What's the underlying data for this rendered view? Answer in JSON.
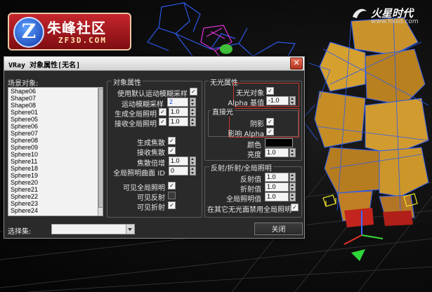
{
  "logos": {
    "left": {
      "badge": "Z",
      "title": "朱峰社区",
      "subtitle": "ZF3D.COM"
    },
    "right": {
      "title": "火星时代",
      "subtitle": "www.hxsd.com"
    }
  },
  "dialog": {
    "title": "VRay 对象属性[无名]",
    "close_glyph": "✕",
    "scene_objects_label": "场景对象:",
    "scene_objects": [
      "Shape06",
      "Shape07",
      "Shape08",
      "Sphere01",
      "Sphere05",
      "Sphere06",
      "Sphere07",
      "Sphere08",
      "Sphere09",
      "Sphere10",
      "Sphere11",
      "Sphere18",
      "Sphere19",
      "Sphere20",
      "Sphere21",
      "Sphere22",
      "Sphere23",
      "Sphere24"
    ],
    "object_props": {
      "title": "对象属性",
      "use_default_motion_blur": {
        "label": "使用默认运动模糊采样",
        "checked": true
      },
      "motion_blur_samples": {
        "label": "运动模糊采样",
        "value": "2"
      },
      "generate_gi": {
        "label": "生成全局照明",
        "checked": true,
        "value": "1.0"
      },
      "receive_gi": {
        "label": "接收全局照明",
        "checked": true,
        "value": "1.0"
      },
      "generate_caustics": {
        "label": "生成焦散",
        "checked": true
      },
      "receive_caustics": {
        "label": "接收焦散",
        "checked": true
      },
      "caustics_multiplier": {
        "label": "焦散倍增",
        "value": "1.0"
      },
      "gi_surface_id": {
        "label": "全局照明曲面 ID",
        "value": "0"
      },
      "visible_gi": {
        "label": "可见全局照明",
        "checked": true
      },
      "visible_reflections": {
        "label": "可见反射",
        "checked": false
      },
      "visible_refractions": {
        "label": "可见折射",
        "checked": true
      }
    },
    "matte_props": {
      "title": "无光属性",
      "matte_object": {
        "label": "无光对象",
        "checked": true
      },
      "alpha_base": {
        "label": "Alpha 基值",
        "value": "-1.0"
      },
      "direct_light_title": "直接光",
      "shadows": {
        "label": "阴影",
        "checked": true
      },
      "affect_alpha": {
        "label": "影响 Alpha",
        "checked": true
      },
      "color_label": "颜色",
      "color": "#000000",
      "brightness": {
        "label": "亮度",
        "value": "1.0"
      }
    },
    "refl_props": {
      "title": "反射/折射/全局照明",
      "reflection_amount": {
        "label": "反射值",
        "value": "1.0"
      },
      "refraction_amount": {
        "label": "折射值",
        "value": "1.0"
      },
      "gi_amount": {
        "label": "全局照明值",
        "value": "1.0"
      },
      "no_gi_on_other_mattes": {
        "label": "在其它无光面禁用全局照明",
        "checked": true
      }
    },
    "selection_set_label": "选择集:",
    "selection_set_value": "",
    "close_button": "关闭"
  }
}
